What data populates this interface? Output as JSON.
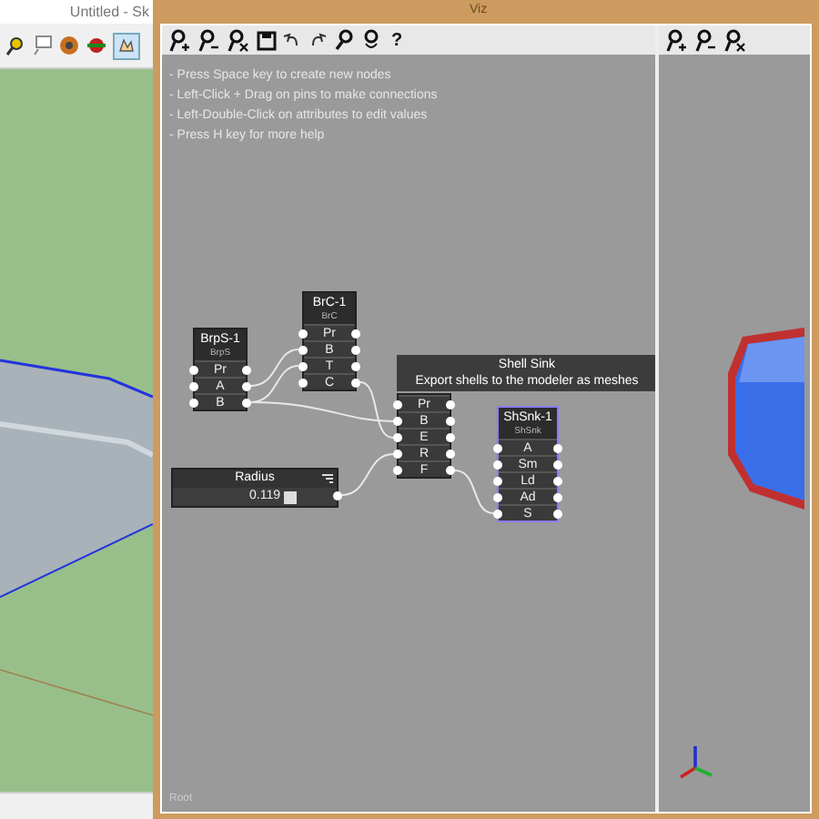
{
  "host_window": {
    "title": "Untitled - Sk"
  },
  "node_editor": {
    "title": "Viz",
    "toolbar_help": "?",
    "help_lines": [
      "- Press Space key to create new nodes",
      "- Left-Click + Drag on pins to make connections",
      "- Left-Double-Click on attributes to edit values",
      "- Press H key for more help"
    ],
    "nodes": [
      {
        "title": "BrpS-1",
        "subtitle": "BrpS",
        "ports": [
          "Pr",
          "A",
          "B"
        ],
        "selected": false
      },
      {
        "title": "BrC-1",
        "subtitle": "BrC",
        "ports": [
          "Pr",
          "B",
          "T",
          "C"
        ],
        "selected": false
      },
      {
        "ports": [
          "Pr",
          "B",
          "E",
          "R",
          "F"
        ],
        "selected": false
      },
      {
        "title": "ShSnk-1",
        "subtitle": "ShSnk",
        "ports": [
          "A",
          "Sm",
          "Ld",
          "Ad",
          "S"
        ],
        "selected": true
      }
    ],
    "tooltip": {
      "title": "Shell Sink",
      "description": "Export shells to the modeler as meshes"
    },
    "slider": {
      "label": "Radius",
      "value": "0.119"
    },
    "breadcrumb": "Root"
  }
}
